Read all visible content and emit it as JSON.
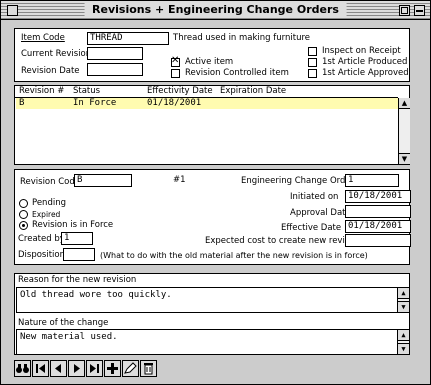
{
  "window": {
    "title": "Revisions + Engineering Change Orders"
  },
  "item": {
    "code_label": "Item Code",
    "code_value": "THREAD",
    "code_desc": "Thread used in making furniture",
    "current_rev_label": "Current Revision",
    "current_rev_value": "",
    "rev_date_label": "Revision Date",
    "rev_date_value": "",
    "active_label": "Active item",
    "active_checked": true,
    "rev_controlled_label": "Revision Controlled item",
    "rev_controlled_checked": false,
    "inspect_label": "Inspect on Receipt",
    "inspect_checked": false,
    "first_produced_label": "1st Article Produced",
    "first_produced_checked": false,
    "first_approved_label": "1st Article Approved",
    "first_approved_checked": false
  },
  "revisions_list": {
    "columns": [
      "Revision #",
      "Status",
      "Effectivity Date",
      "Expiration Date"
    ],
    "rows": [
      {
        "rev": "B",
        "status": "In Force",
        "eff_date": "01/18/2001",
        "exp_date": ""
      }
    ]
  },
  "detail": {
    "rev_code_label": "Revision Code",
    "rev_code_value": "B",
    "seq": "#1",
    "eco_label": "Engineering Change Order #",
    "eco_value": "1",
    "initiated_label": "Initiated on",
    "initiated_value": "10/18/2001",
    "approval_label": "Approval Date",
    "approval_value": "",
    "effective_label": "Effective Date",
    "effective_value": "01/18/2001",
    "pending_label": "Pending",
    "expired_label": "Expired",
    "inforce_label": "Revision is in Force",
    "status_selected": "inforce",
    "created_label": "Created by",
    "created_value": "1",
    "cost_label": "Expected cost to create new revision",
    "cost_value": "",
    "disposition_label": "Disposition",
    "disposition_value": "",
    "disposition_hint": "(What to do with the old material after the new revision is in force)"
  },
  "reason": {
    "label": "Reason for the new revision",
    "text": "Old thread wore too quickly."
  },
  "nature": {
    "label": "Nature of the change",
    "text": "New material used."
  },
  "toolbar": {
    "icons": [
      "binoculars-icon",
      "first-record-icon",
      "prev-record-icon",
      "next-record-icon",
      "last-record-icon",
      "add-record-icon",
      "edit-record-icon",
      "delete-record-icon"
    ]
  }
}
